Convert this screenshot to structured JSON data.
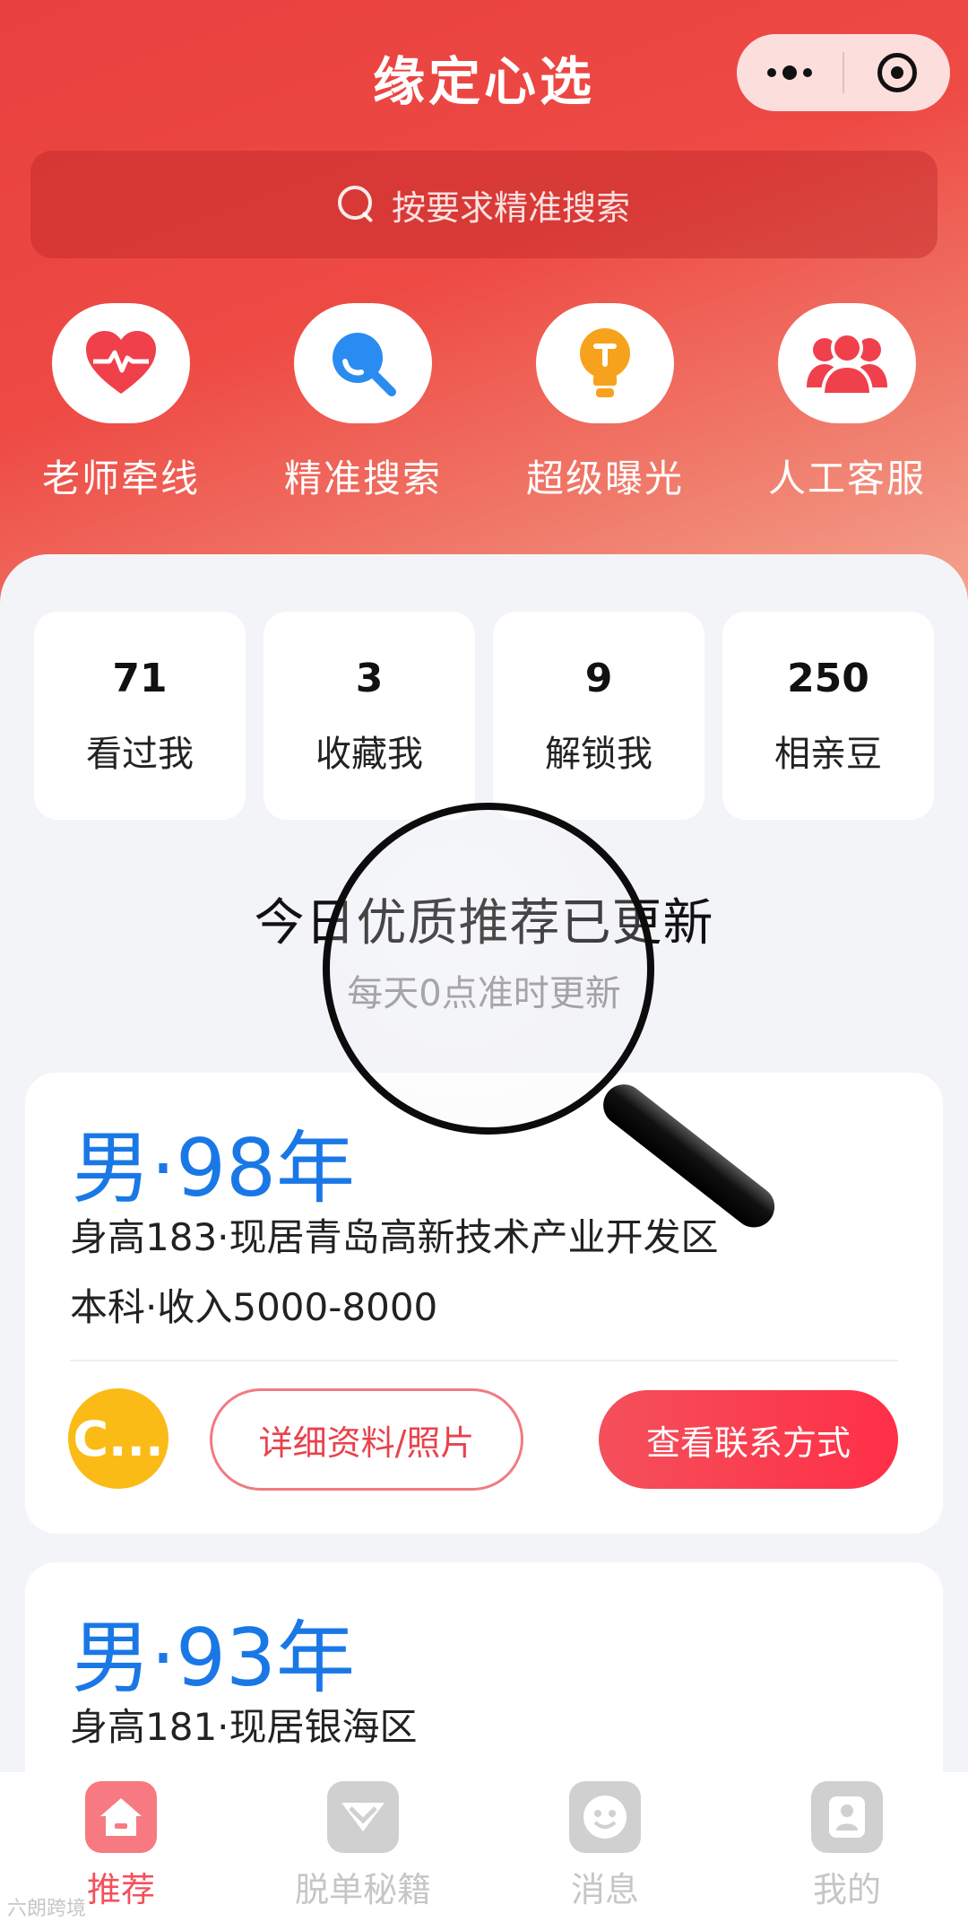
{
  "header": {
    "title": "缘定心选",
    "more_icon": "more-dots-icon",
    "close_icon": "target-icon"
  },
  "search": {
    "placeholder": "按要求精准搜索",
    "icon": "search-icon"
  },
  "quick_actions": [
    {
      "label": "老师牵线",
      "icon": "heart-pulse-icon",
      "color": "#f0404c"
    },
    {
      "label": "精准搜索",
      "icon": "search-blue-icon",
      "color": "#2a8cf0"
    },
    {
      "label": "超级曝光",
      "icon": "lightbulb-icon",
      "color": "#f7a21d"
    },
    {
      "label": "人工客服",
      "icon": "people-icon",
      "color": "#f0404c"
    }
  ],
  "stats": [
    {
      "value": "71",
      "label": "看过我"
    },
    {
      "value": "3",
      "label": "收藏我"
    },
    {
      "value": "9",
      "label": "解锁我"
    },
    {
      "value": "250",
      "label": "相亲豆"
    }
  ],
  "update": {
    "title": "今日优质推荐已更新",
    "subtitle": "每天0点准时更新"
  },
  "cards": [
    {
      "gender_year": "男·98年",
      "line1": "身高183·现居青岛高新技术产业开发区",
      "line2": "本科·收入5000-8000",
      "avatar_text": "C...",
      "detail_button": "详细资料/照片",
      "contact_button": "查看联系方式"
    },
    {
      "gender_year": "男·93年",
      "line1": "身高181·现居银海区"
    }
  ],
  "tabbar": [
    {
      "label": "推荐",
      "icon": "home-icon",
      "active": true
    },
    {
      "label": "脱单秘籍",
      "icon": "chevron-down-icon",
      "active": false
    },
    {
      "label": "消息",
      "icon": "smile-icon",
      "active": false
    },
    {
      "label": "我的",
      "icon": "user-icon",
      "active": false
    }
  ],
  "watermark": "六朗跨境",
  "colors": {
    "primary": "#ee4444",
    "accent_blue": "#1a78e6",
    "tab_active": "#f4505b",
    "tab_inactive": "#c6c6c6"
  }
}
